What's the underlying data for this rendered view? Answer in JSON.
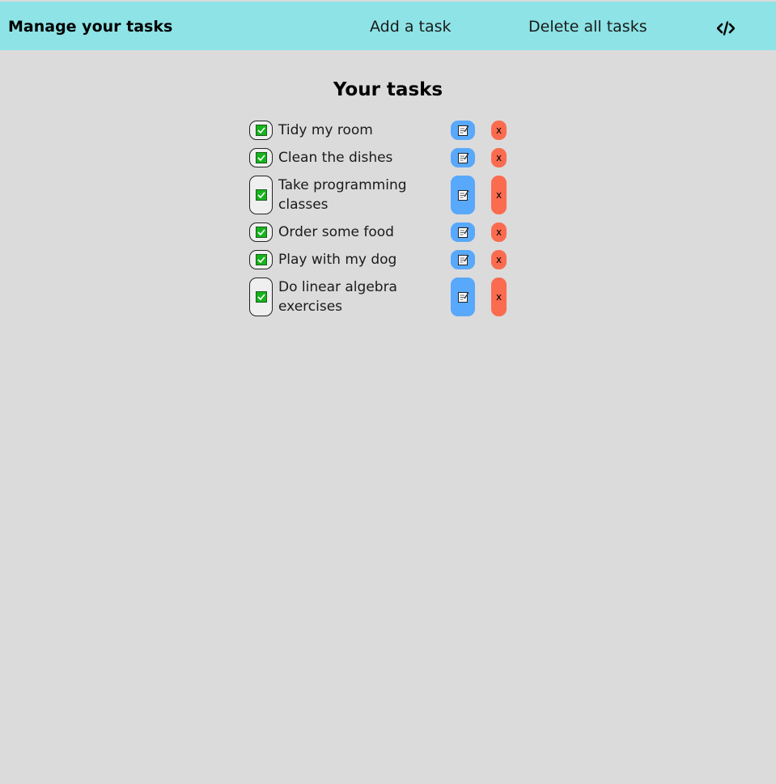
{
  "navbar": {
    "brand": "Manage your tasks",
    "add_label": "Add a task",
    "delete_all_label": "Delete all tasks",
    "code_icon": "code-icon"
  },
  "main": {
    "title": "Your tasks"
  },
  "tasks": [
    {
      "text": "Tidy my room",
      "done": true
    },
    {
      "text": "Clean the dishes",
      "done": true
    },
    {
      "text": "Take programming classes",
      "done": true
    },
    {
      "text": "Order some food",
      "done": true
    },
    {
      "text": "Play with my dog",
      "done": true
    },
    {
      "text": "Do linear algebra exercises",
      "done": true
    }
  ],
  "task_actions": {
    "complete_icon": "checkbox-icon",
    "edit_icon": "memo-icon",
    "delete_label": "x"
  },
  "colors": {
    "navbar": "#8de3e6",
    "background": "#dbdbdb",
    "edit_button": "#58a8fb",
    "delete_button": "#fb6b4f",
    "check": "#17b31c"
  }
}
